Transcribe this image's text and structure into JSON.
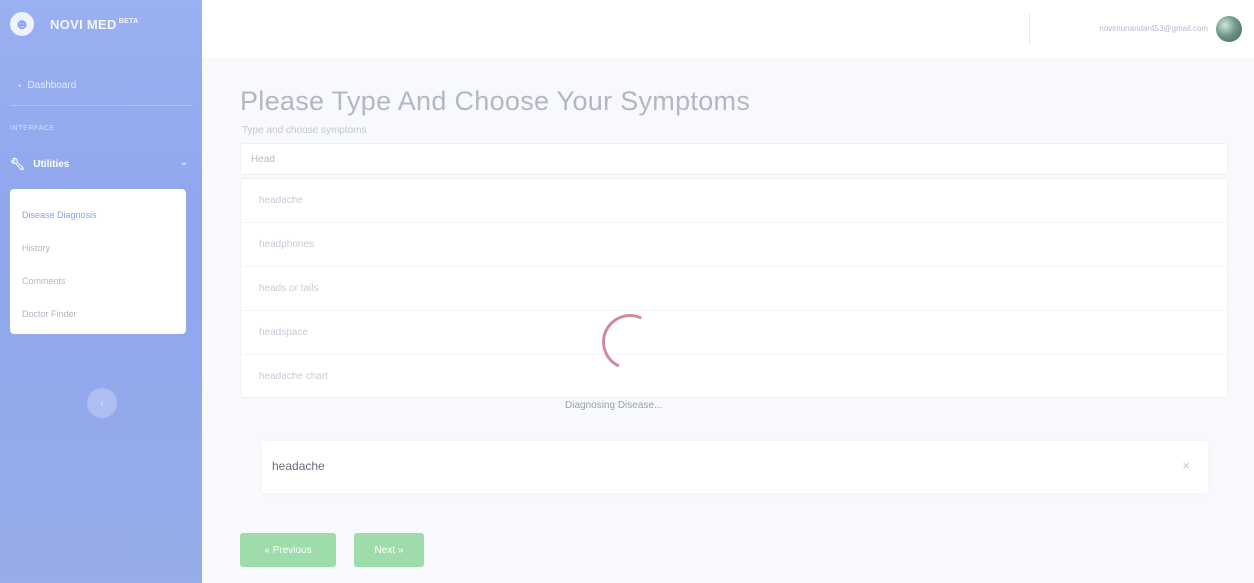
{
  "brand": {
    "logo_glyph": "☻",
    "name": "NOVI MED",
    "badge": "BETA"
  },
  "sidebar": {
    "dashboard_label": "Dashboard",
    "heading": "INTERFACE",
    "utilities_label": "Utilities",
    "submenu": [
      {
        "label": "Disease Diagnosis",
        "active": true
      },
      {
        "label": "History",
        "active": false
      },
      {
        "label": "Comments",
        "active": false
      },
      {
        "label": "Doctor Finder",
        "active": false
      }
    ],
    "toggle_glyph": "‹"
  },
  "topbar": {
    "user_email": "novimunandar453@gmail.com"
  },
  "main": {
    "title": "Please Type And Choose Your Symptoms",
    "form_label": "Type and choose symptoms",
    "search_value": "Head",
    "suggestions": [
      "headache",
      "headphones",
      "heads or tails",
      "headspace",
      "headache chart"
    ],
    "selected_symptom": "headache",
    "close_glyph": "×",
    "prev_label": "« Previous",
    "next_label": "Next »"
  },
  "loading": {
    "text": "Diagnosing Disease..."
  },
  "colors": {
    "sidebar": "#8fa6ee",
    "button_green": "#9fdcab",
    "spinner": "#d08b98"
  }
}
